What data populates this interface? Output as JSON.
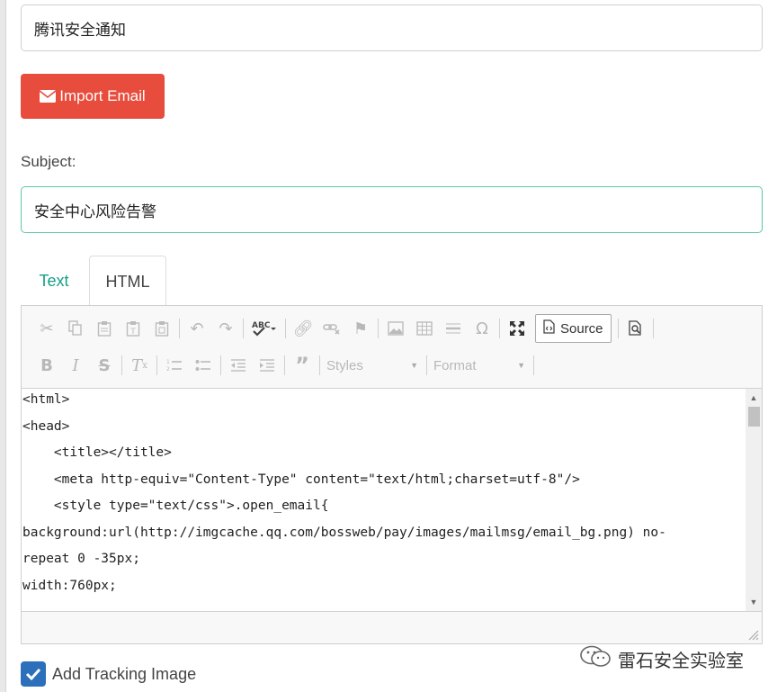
{
  "campaign": {
    "name_value": "腾讯安全通知"
  },
  "import_button": {
    "label": "Import Email",
    "icon": "envelope-icon",
    "color": "#e74c3c"
  },
  "subject": {
    "label": "Subject:",
    "value": "安全中心风险告警"
  },
  "tabs": [
    {
      "label": "Text",
      "active": false
    },
    {
      "label": "HTML",
      "active": true
    }
  ],
  "editor": {
    "toolbar_row1": [
      "cut-icon",
      "copy-icon",
      "paste-icon",
      "paste-text-icon",
      "paste-word-icon",
      "undo-icon",
      "redo-icon",
      "spellcheck-icon",
      "link-icon",
      "unlink-icon",
      "anchor-icon",
      "image-icon",
      "table-icon",
      "horizontal-line-icon",
      "special-char-icon",
      "maximize-icon",
      "source-button",
      "preview-icon"
    ],
    "source_label": "Source",
    "toolbar_row2": [
      "bold-icon",
      "italic-icon",
      "strike-icon",
      "remove-format-icon",
      "numbered-list-icon",
      "bulleted-list-icon",
      "outdent-icon",
      "indent-icon",
      "blockquote-icon"
    ],
    "styles_label": "Styles",
    "format_label": "Format",
    "code_lines": [
      "<html>",
      "<head>",
      "    <title></title>",
      "    <meta http-equiv=\"Content-Type\" content=\"text/html;charset=utf-8\"/>",
      "    <style type=\"text/css\">.open_email{",
      "background:url(http://imgcache.qq.com/bossweb/pay/images/mailmsg/email_bg.png) no-",
      "repeat 0 -35px;",
      "width:760px;"
    ]
  },
  "tracking": {
    "label": "Add Tracking Image",
    "checked": true,
    "color": "#2c6fbb"
  },
  "watermark": {
    "text": "雷石安全实验室"
  },
  "colors": {
    "accent": "#16a085",
    "subject_border": "#5cc6a8"
  }
}
